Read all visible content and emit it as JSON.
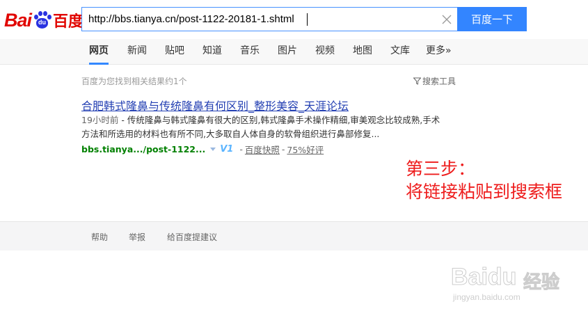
{
  "logo": {
    "bai": "Bai",
    "du": "du",
    "cn": "百度"
  },
  "search": {
    "query": "http://bbs.tianya.cn/post-1122-20181-1.shtml",
    "button_label": "百度一下"
  },
  "nav": {
    "items": [
      {
        "label": "网页",
        "active": true
      },
      {
        "label": "新闻"
      },
      {
        "label": "贴吧"
      },
      {
        "label": "知道"
      },
      {
        "label": "音乐"
      },
      {
        "label": "图片"
      },
      {
        "label": "视频"
      },
      {
        "label": "地图"
      },
      {
        "label": "文库"
      },
      {
        "label": "更多»"
      }
    ]
  },
  "results": {
    "count_text": "百度为您找到相关结果约1个",
    "tools_label": "搜索工具",
    "items": [
      {
        "title": "合肥韩式隆鼻与传统隆鼻有何区别_整形美容_天涯论坛",
        "time": "19小时前",
        "abstract_line1": " - 传统隆鼻与韩式隆鼻有很大的区别,韩式隆鼻手术操作精细,审美观念比较成熟,手术",
        "abstract_line2": "方法和所选用的材料也有所不同,大多取自人体自身的软骨组织进行鼻部修复...",
        "url": "bbs.tianya.../post-1122...",
        "v_badge": "V1",
        "separator": "-",
        "snapshot_label": "百度快照",
        "rating_label": "75%好评"
      }
    ]
  },
  "annotation": {
    "line1": "第三步：",
    "line2": "将链接粘贴到搜索框"
  },
  "footer": {
    "links": [
      "帮助",
      "举报",
      "给百度提建议"
    ]
  },
  "watermark": {
    "main": "Baidu",
    "cn": "经验",
    "sub": "jingyan.baidu.com"
  },
  "colors": {
    "accent": "#3385ff",
    "logo_red": "#e10601",
    "logo_blue": "#2932e1",
    "link": "#2440b3",
    "url_green": "#008000",
    "annotation_red": "#ee1c1c"
  }
}
